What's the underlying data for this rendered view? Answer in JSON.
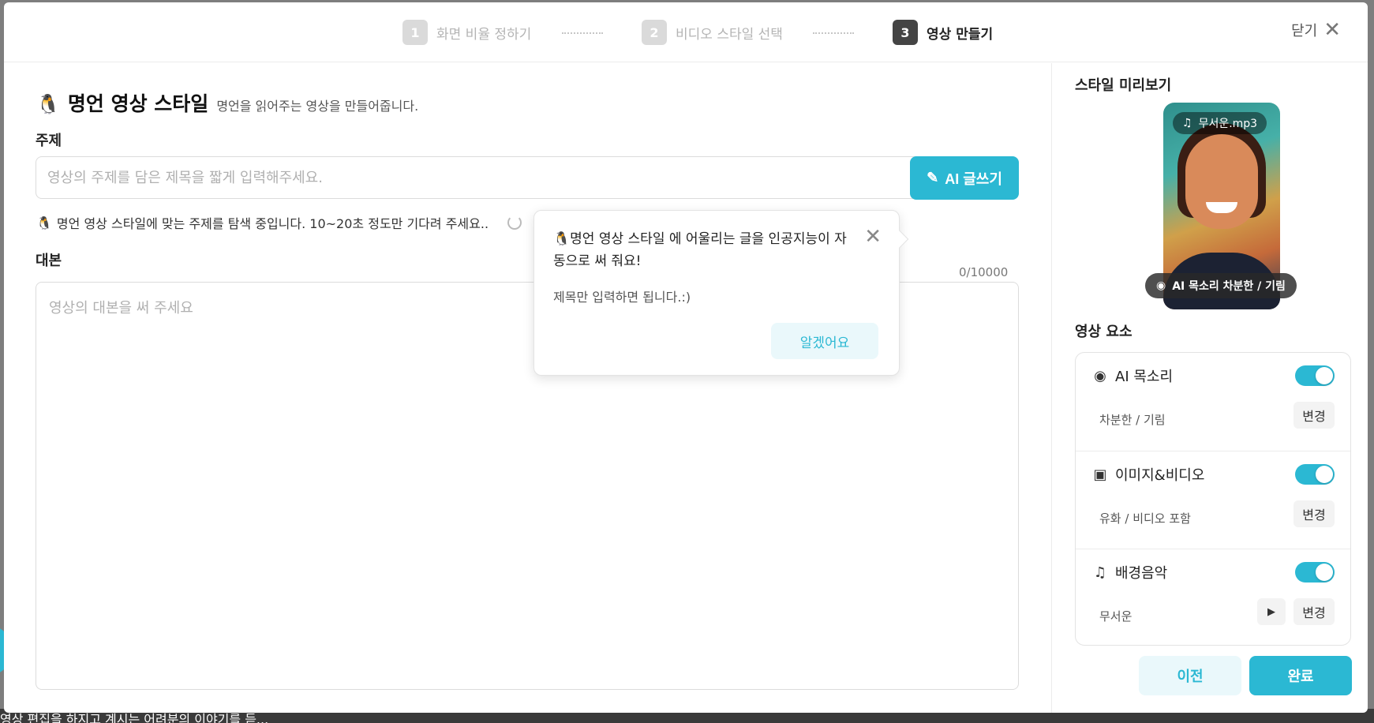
{
  "header": {
    "steps": [
      {
        "num": "1",
        "label": "화면 비율 정하기"
      },
      {
        "num": "2",
        "label": "비디오 스타일 선택"
      },
      {
        "num": "3",
        "label": "영상 만들기"
      }
    ],
    "close_label": "닫기"
  },
  "style": {
    "icon": "🐧",
    "title": "명언 영상 스타일",
    "description": "명언을 읽어주는 영상을 만들어줍니다."
  },
  "topic": {
    "label": "주제",
    "placeholder": "영상의 주제를 담은 제목을 짧게 입력해주세요.",
    "value": "",
    "ai_button": "AI 글쓰기",
    "searching_text": "명언 영상 스타일에 맞는 주제를 탐색 중입니다. 10~20초 정도만 기다려 주세요.."
  },
  "script": {
    "label": "대본",
    "placeholder": "영상의 대본을 써 주세요",
    "counter": "0/10000"
  },
  "popover": {
    "title": "명언 영상 스타일 에 어울리는 글을 인공지능이 자동으로 써 줘요!",
    "body": "제목만 입력하면 됩니다.:)",
    "button": "알겠어요"
  },
  "preview": {
    "label": "스타일 미리보기",
    "music_file": "무서운.mp3",
    "voice_badge": "AI 목소리  차분한 / 기림"
  },
  "elements": {
    "label": "영상 요소",
    "items": [
      {
        "icon": "voice-icon",
        "name": "AI 목소리",
        "enabled": true,
        "value": "차분한 / 기림",
        "change": "변경"
      },
      {
        "icon": "image-video-icon",
        "name": "이미지&비디오",
        "enabled": true,
        "value": "유화 / 비디오 포함",
        "change": "변경"
      },
      {
        "icon": "music-note-icon",
        "name": "배경음악",
        "enabled": true,
        "value": "무서운",
        "change": "변경"
      }
    ]
  },
  "footer": {
    "prev": "이전",
    "done": "완료"
  },
  "backdrop": {
    "text": "영상 편집을 하지고 계시는 어려분의 이야기를 듣..."
  },
  "colors": {
    "accent": "#2bb8d3",
    "accent_light": "#eaf8fb"
  }
}
